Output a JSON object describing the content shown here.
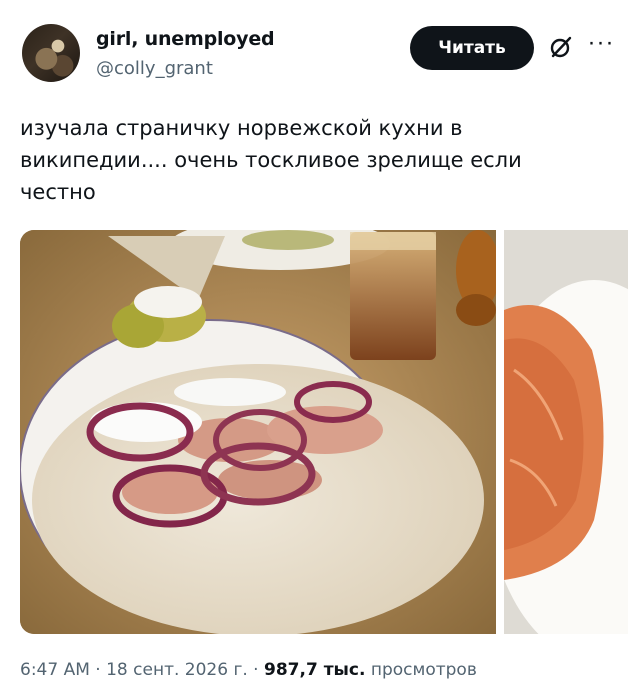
{
  "author": {
    "display_name": "girl, unemployed",
    "handle": "@colly_grant"
  },
  "actions": {
    "follow_label": "Читать",
    "grok_icon": "grok-slash-icon",
    "more_icon": "more-horizontal-icon"
  },
  "tweet": {
    "text": "изучала страничку норвежской кухни в\nвикипедии.... очень тоскливое зрелище если\nчестно"
  },
  "media": {
    "photo_main_icon": "food-photo-lefse-salmon-onion",
    "photo_second_icon": "food-photo-smoked-salmon-plate"
  },
  "meta": {
    "time": "6:47 AM",
    "sep1": " · ",
    "date": "18 сент. 2026 г.",
    "sep2": " · ",
    "views_count": "987,7 тыс.",
    "views_label": " просмотров"
  }
}
